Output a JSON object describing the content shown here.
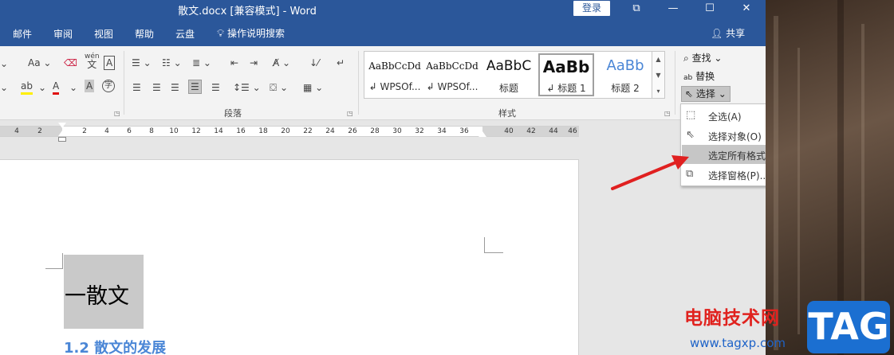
{
  "window": {
    "title": "散文.docx [兼容模式] - Word",
    "login_label": "登录",
    "restore_glyph": "⧉",
    "minimize_glyph": "—",
    "maximize_glyph": "☐",
    "close_glyph": "✕"
  },
  "menu": {
    "tabs": [
      "邮件",
      "审阅",
      "视图",
      "帮助",
      "云盘"
    ],
    "tell_me": "操作说明搜索",
    "share": "共享"
  },
  "ribbon": {
    "font_group": {
      "change_case": "Aa",
      "phonetic_top": "wén",
      "phonetic_bottom": "文",
      "char_border": "A",
      "highlight": "ab",
      "font_color": "A",
      "char_shading": "A",
      "enclose": "字"
    },
    "paragraph_label": "段落",
    "styles_label": "样式",
    "styles": [
      {
        "sample": "AaBbCcDd",
        "name": "WPSOf..."
      },
      {
        "sample": "AaBbCcDd",
        "name": "WPSOf..."
      },
      {
        "sample": "AaBbC",
        "name": "标题"
      },
      {
        "sample": "AaBb",
        "name": "标题 1"
      },
      {
        "sample": "AaBb",
        "name": "标题 2"
      }
    ],
    "edit": {
      "find": "查找",
      "replace": "替换",
      "select": "选择"
    }
  },
  "ruler": {
    "left_ticks": [
      "4",
      "2"
    ],
    "ticks": [
      "2",
      "4",
      "6",
      "8",
      "10",
      "12",
      "14",
      "16",
      "18",
      "20",
      "22",
      "24",
      "26",
      "28",
      "30",
      "32",
      "34",
      "36",
      "40",
      "42",
      "44",
      "46"
    ]
  },
  "select_menu": {
    "items": [
      {
        "icon": "select-all-icon",
        "label": "全选(A)"
      },
      {
        "icon": "select-objects-icon",
        "label": "选择对象(O)"
      },
      {
        "icon": "select-similar-icon",
        "label": "选定所有格式类似的文本(无数据)(S)"
      },
      {
        "icon": "selection-pane-icon",
        "label": "选择窗格(P)..."
      }
    ]
  },
  "document": {
    "title": "一散文",
    "heading": "1.2 散文的发展"
  },
  "watermark": {
    "site_name": "电脑技术网",
    "url": "www.tagxp.com",
    "tag": "TAG"
  },
  "colors": {
    "accent": "#2b579a",
    "heading_blue": "#4a86d6",
    "arrow_red": "#e02020"
  }
}
